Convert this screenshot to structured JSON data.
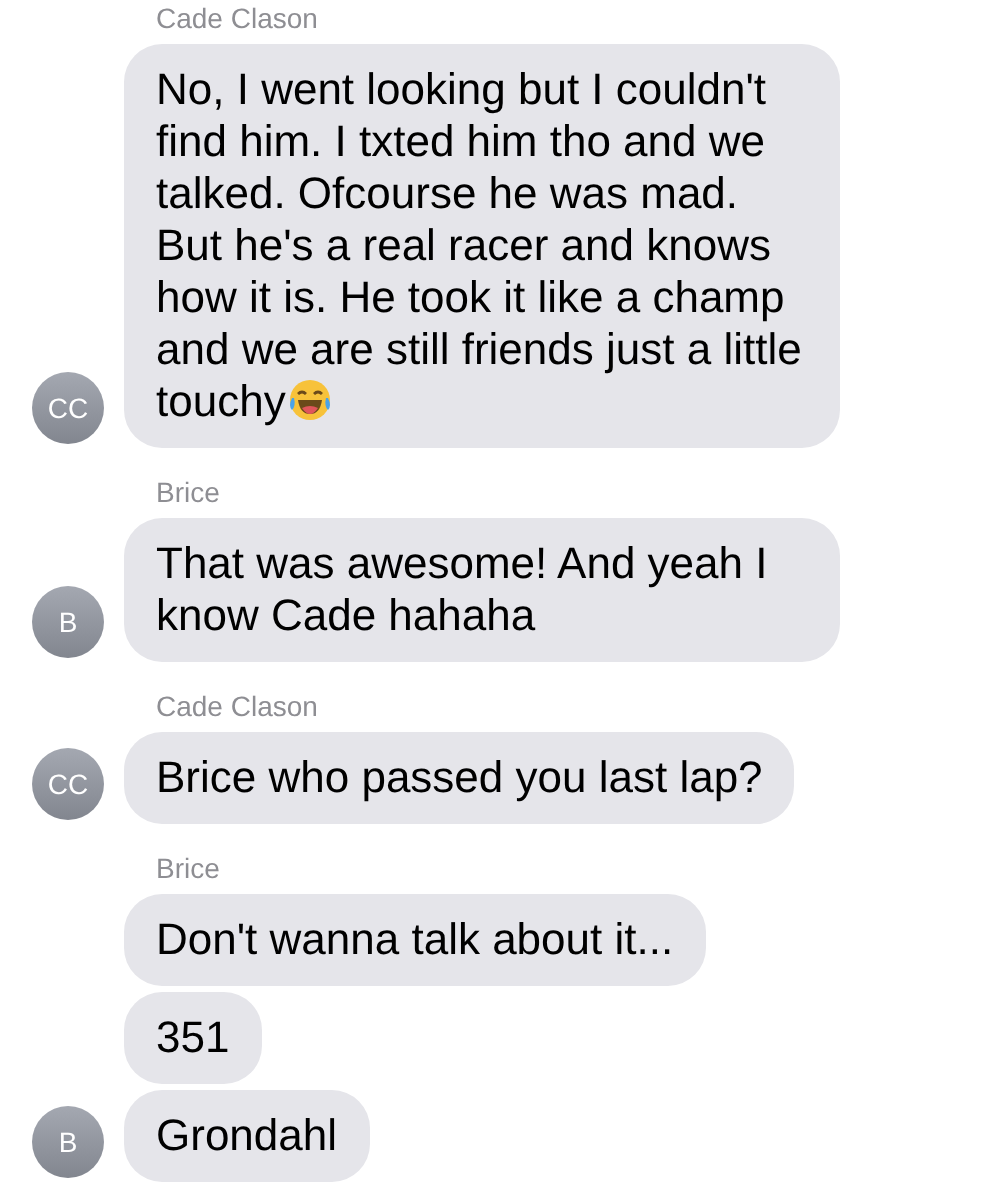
{
  "conversation": [
    {
      "sender": "Cade Clason",
      "avatar": "CC",
      "messages": [
        {
          "text": "No, I went looking but I couldn't find him. I txted him tho and we talked. Ofcourse he was mad. But he's a real racer and knows how it is. He took it like a champ and we are still friends just a little touchy",
          "emoji": true
        }
      ]
    },
    {
      "sender": "Brice",
      "avatar": "B",
      "messages": [
        {
          "text": "That was awesome! And yeah I know Cade hahaha"
        }
      ]
    },
    {
      "sender": "Cade Clason",
      "avatar": "CC",
      "messages": [
        {
          "text": "Brice who passed you last lap?"
        }
      ]
    },
    {
      "sender": "Brice",
      "avatar": "B",
      "messages": [
        {
          "text": "Don't wanna talk about it..."
        },
        {
          "text": "351"
        },
        {
          "text": "Grondahl"
        }
      ]
    }
  ]
}
